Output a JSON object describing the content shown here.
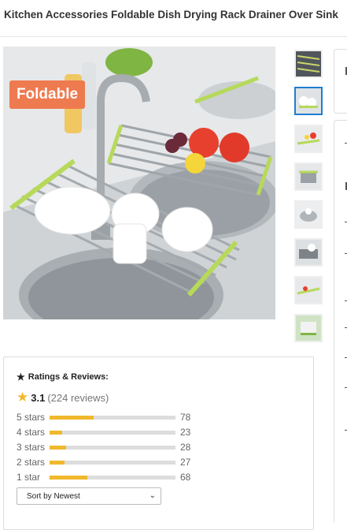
{
  "product": {
    "title": "Kitchen Accessories Foldable Dish Drying Rack Drainer Over Sink"
  },
  "main_image": {
    "badge_text": "Foldable"
  },
  "thumbnails": [
    {
      "name": "thumb-1",
      "selected": false
    },
    {
      "name": "thumb-2",
      "selected": true
    },
    {
      "name": "thumb-3",
      "selected": false
    },
    {
      "name": "thumb-4",
      "selected": false
    },
    {
      "name": "thumb-5",
      "selected": false
    },
    {
      "name": "thumb-6",
      "selected": false
    },
    {
      "name": "thumb-7",
      "selected": false
    },
    {
      "name": "thumb-8",
      "selected": false
    }
  ],
  "ratings": {
    "heading": "Ratings & Reviews:",
    "average": "3.1",
    "review_count_text": "(224 reviews)",
    "breakdown": [
      {
        "label": "5 stars",
        "count": "78",
        "fraction": 0.35
      },
      {
        "label": "4 stars",
        "count": "23",
        "fraction": 0.1
      },
      {
        "label": "3 stars",
        "count": "28",
        "fraction": 0.13
      },
      {
        "label": "2 stars",
        "count": "27",
        "fraction": 0.12
      },
      {
        "label": "1 star",
        "count": "68",
        "fraction": 0.3
      }
    ],
    "sort_selected": "Sort by Newest"
  },
  "colors": {
    "accent_star": "#f0b82c",
    "selected_thumb_border": "#1f7ed0",
    "badge_bg": "#ee7a50"
  },
  "icons": {
    "heading_icon": "star-icon",
    "average_icon": "star-icon",
    "sort_icon": "chevron-down-icon"
  }
}
